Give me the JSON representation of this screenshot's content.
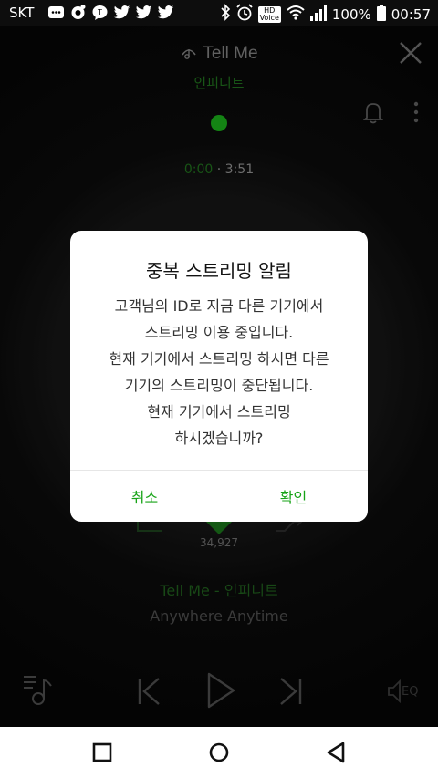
{
  "status_bar": {
    "carrier": "SKT",
    "hd_voice": "HD\nVoice",
    "battery": "100%",
    "time": "00:57"
  },
  "player": {
    "song_title": "Tell Me",
    "artist": "인피니트",
    "time_current": "0:00",
    "time_separator": " · ",
    "time_total": "3:51",
    "like_count": "34,927",
    "track_line": "Tell Me - 인피니트",
    "album": "Anywhere Anytime",
    "eq_label": "EQ"
  },
  "dialog": {
    "title": "중복 스트리밍 알림",
    "message_lines": [
      "고객님의 ID로 지금 다른 기기에서",
      "스트리밍 이용 중입니다.",
      "현재 기기에서 스트리밍 하시면 다른",
      "기기의 스트리밍이 중단됩니다.",
      "현재 기기에서 스트리밍",
      "하시겠습니까?"
    ],
    "cancel_label": "취소",
    "confirm_label": "확인"
  },
  "colors": {
    "accent_green": "#17a317",
    "dim_green": "#1f6b1c"
  }
}
